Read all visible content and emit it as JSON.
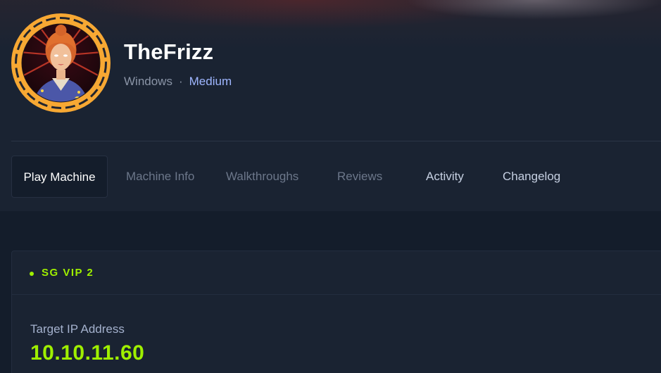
{
  "machine": {
    "name": "TheFrizz",
    "os": "Windows",
    "separator": "·",
    "difficulty": "Medium"
  },
  "tabs": [
    {
      "label": "Play Machine",
      "state": "active"
    },
    {
      "label": "Machine Info",
      "state": "dim"
    },
    {
      "label": "Walkthroughs",
      "state": "dim"
    },
    {
      "label": "Reviews",
      "state": "dim"
    },
    {
      "label": "Activity",
      "state": "normal"
    },
    {
      "label": "Changelog",
      "state": "normal"
    }
  ],
  "connection": {
    "server": "SG VIP 2",
    "status": "online",
    "ip_label": "Target IP Address",
    "ip_value": "10.10.11.60"
  },
  "colors": {
    "accent_green": "#9fef00",
    "difficulty_blue": "#9fb6ff",
    "avatar_ring": "#f7a833",
    "background": "#141d2b"
  },
  "icons": {
    "avatar": "machine-avatar-witch-portrait",
    "status": "status-dot-icon"
  }
}
